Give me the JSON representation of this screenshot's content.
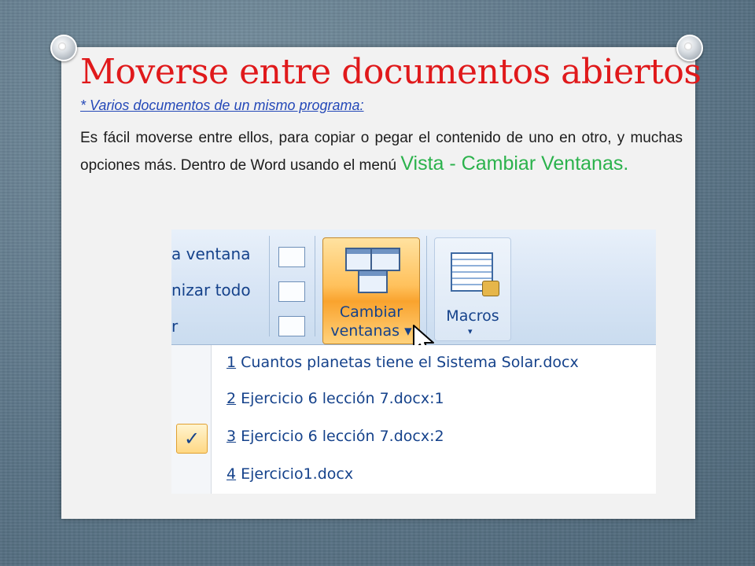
{
  "slide": {
    "title": "Moverse entre documentos abiertos",
    "subtitle": "* Varios documentos de un mismo programa:",
    "body": "Es fácil moverse entre ellos, para copiar o pegar el contenido de uno en otro, y muchas opciones más. Dentro de Word usando el menú ",
    "highlight": "Vista - Cambiar Ventanas.",
    "highlight_color": "#2bb24c",
    "title_color": "#e0191b"
  },
  "ribbon": {
    "left_items": [
      "a ventana",
      "nizar todo",
      "r"
    ],
    "cambiar_label_1": "Cambiar",
    "cambiar_label_2": "ventanas",
    "macros_label": "Macros",
    "dropdown_glyph": "▾"
  },
  "menu": {
    "items": [
      {
        "num": "1",
        "label": " Cuantos planetas tiene el Sistema Solar.docx",
        "checked": false
      },
      {
        "num": "2",
        "label": " Ejercicio 6 lección 7.docx:1",
        "checked": false
      },
      {
        "num": "3",
        "label": " Ejercicio 6 lección 7.docx:2",
        "checked": true
      },
      {
        "num": "4",
        "label": " Ejercicio1.docx",
        "checked": false
      }
    ],
    "check_glyph": "✓"
  }
}
